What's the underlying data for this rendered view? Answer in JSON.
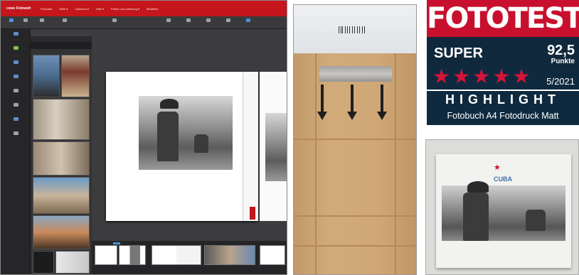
{
  "editor": {
    "brand": "cewe  Fotowelt",
    "menu": [
      "Produkte",
      "Seite ▾",
      "Optionen ▾",
      "Hilfe ▾",
      "Preise und Lieferung ▾",
      "Bestellen"
    ],
    "toolbar": [
      "",
      "",
      "",
      "",
      "",
      "",
      "",
      "",
      "",
      ""
    ],
    "rail": [
      "",
      "",
      "",
      "",
      "",
      "",
      "",
      ""
    ],
    "panel": {
      "head": "",
      "sub": "",
      "folder": ""
    },
    "page_label": "",
    "colors": {
      "accent": "#c4161c",
      "canvas": "#3c3c3f",
      "selection": "#4a90d9"
    }
  },
  "packaging": {
    "colors": {
      "cardboard": "#cfa776",
      "arrows": "#1e1e1e"
    }
  },
  "badge": {
    "title": "FOTOTEST",
    "rating": "SUPER",
    "score": "92,5",
    "score_unit": "Punkte",
    "stars": 5,
    "issue": "5/2021",
    "highlight": "HIGHLIGHT",
    "product": "Fotobuch A4 Fotodruck Matt",
    "colors": {
      "red": "#c8102e",
      "navy": "#0f2a3f"
    }
  },
  "book_cover": {
    "title": "CUBA",
    "caption": ""
  }
}
